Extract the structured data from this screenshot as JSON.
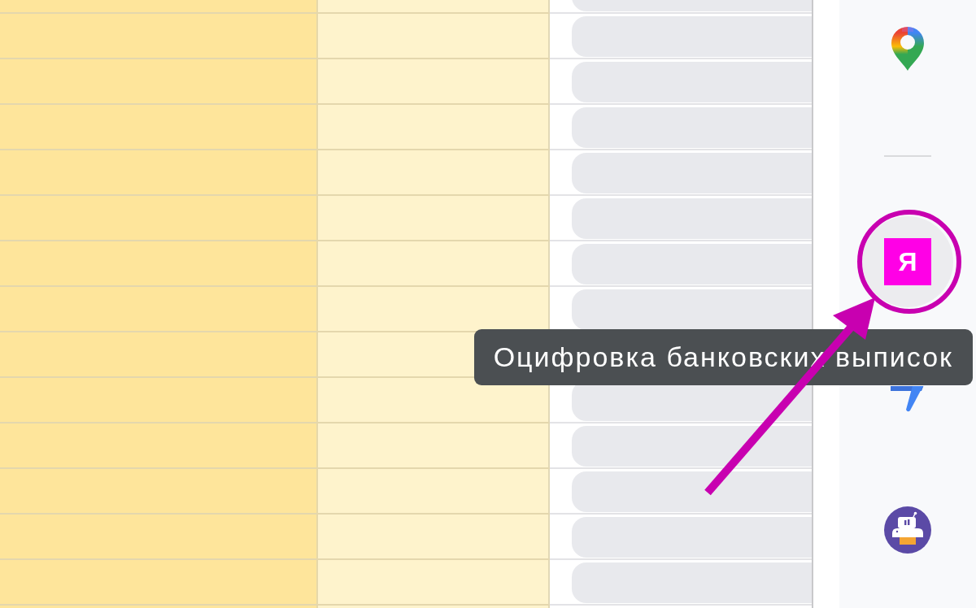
{
  "sheet": {
    "columns": [
      {
        "kind": "shaded"
      },
      {
        "kind": "tinted"
      },
      {
        "kind": "chip"
      }
    ]
  },
  "side_panel": {
    "items": [
      {
        "kind": "maps",
        "hovered": false,
        "annotated": false
      },
      {
        "kind": "divider"
      },
      {
        "kind": "letter_tile",
        "letter": "Я",
        "hovered": true,
        "annotated": true
      },
      {
        "kind": "tasks",
        "hovered": false,
        "annotated": false
      },
      {
        "kind": "robot",
        "hovered": false,
        "annotated": false
      }
    ]
  },
  "tooltip": {
    "text": "Оцифровка банковских выписок"
  }
}
